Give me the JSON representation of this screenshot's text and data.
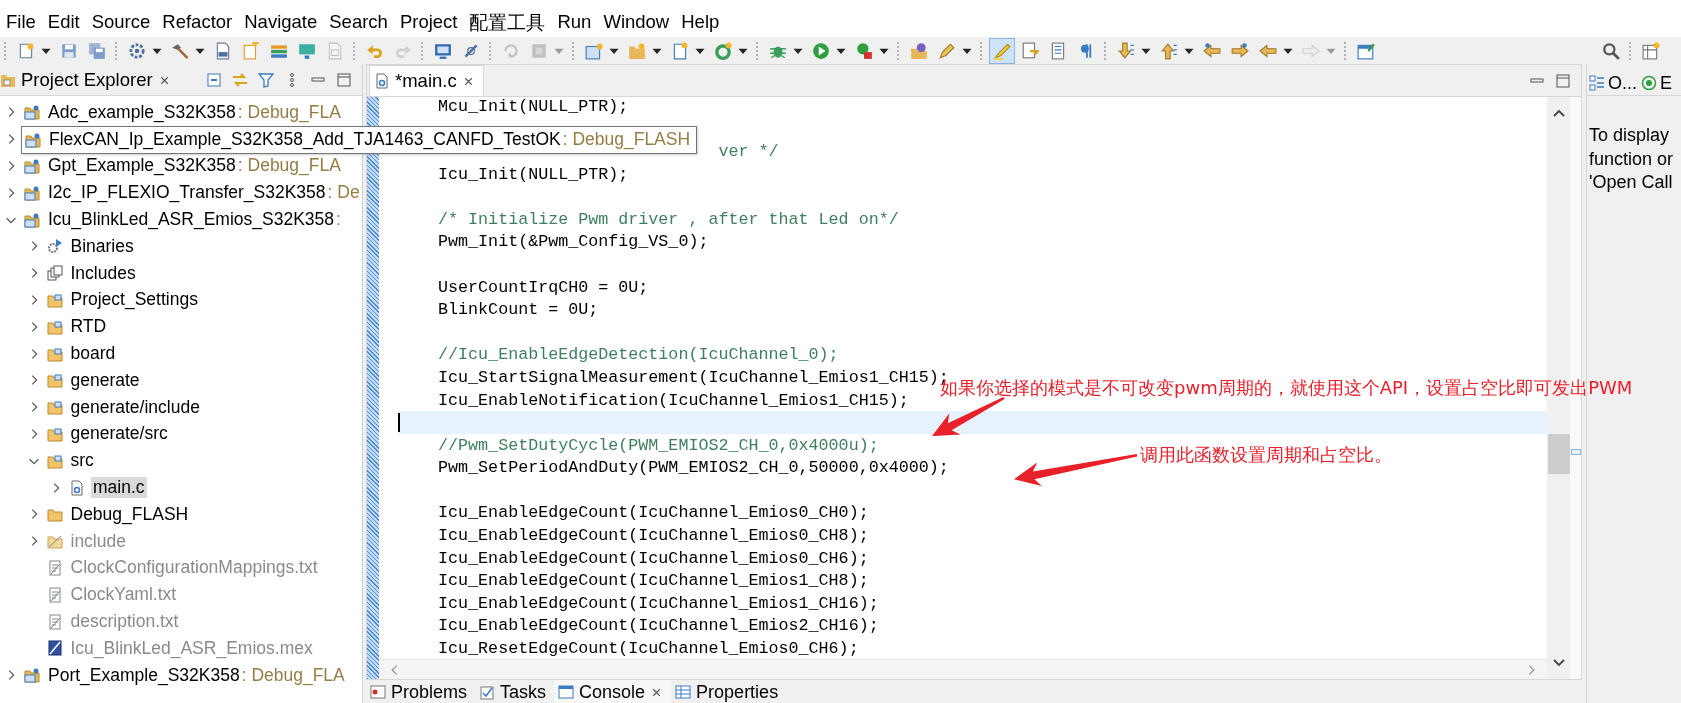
{
  "menu": [
    "File",
    "Edit",
    "Source",
    "Refactor",
    "Navigate",
    "Search",
    "Project",
    "配置工具",
    "Run",
    "Window",
    "Help"
  ],
  "toolbar": {
    "groups": [
      [
        {
          "dropdown": true,
          "selected": false,
          "disabled": false
        },
        {
          "dropdown": false,
          "selected": false,
          "disabled": false
        },
        {
          "dropdown": false,
          "selected": false,
          "disabled": false
        }
      ],
      [
        {
          "dropdown": true,
          "selected": false,
          "disabled": false
        },
        {
          "dropdown": true,
          "selected": false,
          "disabled": false
        },
        {
          "dropdown": false,
          "selected": false,
          "disabled": false
        },
        {
          "dropdown": false,
          "selected": false,
          "disabled": false
        },
        {
          "dropdown": false,
          "selected": false,
          "disabled": false
        },
        {
          "dropdown": false,
          "selected": false,
          "disabled": false
        },
        {
          "dropdown": false,
          "selected": false,
          "disabled": true
        }
      ],
      [
        {
          "dropdown": false,
          "selected": false,
          "disabled": false
        },
        {
          "dropdown": false,
          "selected": false,
          "disabled": true
        }
      ],
      [
        {
          "dropdown": false,
          "selected": false,
          "disabled": false
        },
        {
          "dropdown": false,
          "selected": false,
          "disabled": false
        }
      ],
      [
        {
          "dropdown": false,
          "selected": false,
          "disabled": true
        },
        {
          "dropdown": true,
          "selected": false,
          "disabled": true
        }
      ],
      [
        {
          "dropdown": true,
          "selected": false,
          "disabled": false
        },
        {
          "dropdown": true,
          "selected": false,
          "disabled": false
        },
        {
          "dropdown": true,
          "selected": false,
          "disabled": false
        },
        {
          "dropdown": true,
          "selected": false,
          "disabled": false
        }
      ],
      [
        {
          "dropdown": true,
          "selected": false,
          "disabled": false
        },
        {
          "dropdown": true,
          "selected": false,
          "disabled": false
        },
        {
          "dropdown": true,
          "selected": false,
          "disabled": false
        }
      ],
      [
        {
          "dropdown": false,
          "selected": false,
          "disabled": false
        },
        {
          "dropdown": true,
          "selected": false,
          "disabled": false
        }
      ],
      [
        {
          "dropdown": false,
          "selected": true,
          "disabled": false
        },
        {
          "dropdown": false,
          "selected": false,
          "disabled": false
        },
        {
          "dropdown": false,
          "selected": false,
          "disabled": false
        },
        {
          "dropdown": false,
          "selected": false,
          "disabled": false
        }
      ],
      [
        {
          "dropdown": true,
          "selected": false,
          "disabled": false
        },
        {
          "dropdown": true,
          "selected": false,
          "disabled": false
        },
        {
          "dropdown": false,
          "selected": false,
          "disabled": false
        },
        {
          "dropdown": false,
          "selected": false,
          "disabled": false
        },
        {
          "dropdown": true,
          "selected": false,
          "disabled": false
        },
        {
          "dropdown": true,
          "selected": false,
          "disabled": true
        }
      ],
      [
        {
          "dropdown": false,
          "selected": false,
          "disabled": false
        }
      ]
    ]
  },
  "project_explorer": {
    "title": "Project Explorer",
    "items": [
      {
        "label": "Adc_example_S32K358",
        "decoration": ": Debug_FLA",
        "kind": "project",
        "expanded": false,
        "selected": false,
        "dimmed": false,
        "tooltip": false
      },
      {
        "label": "FlexCAN_Ip_Example_S32K358_Add_TJA1463_CANFD_TestOK",
        "decoration": ": Debug_FLASH",
        "kind": "project",
        "expanded": false,
        "selected": false,
        "dimmed": false,
        "tooltip": true
      },
      {
        "label": "Gpt_Example_S32K358",
        "decoration": ": Debug_FLA",
        "kind": "project",
        "expanded": false,
        "selected": false,
        "dimmed": false,
        "tooltip": false
      },
      {
        "label": "I2c_IP_FLEXIO_Transfer_S32K358",
        "decoration": ": De",
        "kind": "project",
        "expanded": false,
        "selected": false,
        "dimmed": false,
        "tooltip": false
      },
      {
        "label": "Icu_BlinkLed_ASR_Emios_S32K358",
        "decoration": ":",
        "kind": "project",
        "expanded": true,
        "selected": false,
        "dimmed": false,
        "tooltip": false,
        "children": [
          {
            "label": "Binaries",
            "kind": "binaries",
            "expanded": false,
            "selected": false,
            "dimmed": false
          },
          {
            "label": "Includes",
            "kind": "includes",
            "expanded": false,
            "selected": false,
            "dimmed": false
          },
          {
            "label": "Project_Settings",
            "kind": "source_folder",
            "expanded": false,
            "selected": false,
            "dimmed": false
          },
          {
            "label": "RTD",
            "kind": "source_folder",
            "expanded": false,
            "selected": false,
            "dimmed": false
          },
          {
            "label": "board",
            "kind": "source_folder",
            "expanded": false,
            "selected": false,
            "dimmed": false
          },
          {
            "label": "generate",
            "kind": "source_folder",
            "expanded": false,
            "selected": false,
            "dimmed": false
          },
          {
            "label": "generate/include",
            "kind": "source_folder",
            "expanded": false,
            "selected": false,
            "dimmed": false
          },
          {
            "label": "generate/src",
            "kind": "source_folder",
            "expanded": false,
            "selected": false,
            "dimmed": false
          },
          {
            "label": "src",
            "kind": "source_folder",
            "expanded": true,
            "selected": false,
            "dimmed": false,
            "children": [
              {
                "label": "main.c",
                "kind": "c_file",
                "expanded": false,
                "selected": true,
                "dimmed": false
              }
            ]
          },
          {
            "label": "Debug_FLASH",
            "kind": "folder",
            "expanded": false,
            "selected": false,
            "dimmed": false
          },
          {
            "label": "include",
            "kind": "excluded_folder",
            "expanded": false,
            "selected": false,
            "dimmed": true
          },
          {
            "label": "ClockConfigurationMappings.txt",
            "kind": "text_file",
            "selected": false,
            "dimmed": true
          },
          {
            "label": "ClockYaml.txt",
            "kind": "text_file",
            "selected": false,
            "dimmed": true
          },
          {
            "label": "description.txt",
            "kind": "text_file",
            "selected": false,
            "dimmed": true
          },
          {
            "label": "Icu_BlinkLed_ASR_Emios.mex",
            "kind": "mex_file",
            "selected": false,
            "dimmed": true
          }
        ]
      },
      {
        "label": "Port_Example_S32K358",
        "decoration": ": Debug_FLA",
        "kind": "project",
        "expanded": false,
        "selected": false,
        "dimmed": false,
        "tooltip": false
      }
    ]
  },
  "editor": {
    "tabs": [
      {
        "label": "*main.c",
        "selected": true
      }
    ],
    "lines": [
      {
        "kind": "code",
        "text": "Mcu_Init(NULL_PTR);",
        "current": false
      },
      {
        "kind": "blank",
        "current": false
      },
      {
        "kind": "comment_tail",
        "text": "ver */",
        "current": false
      },
      {
        "kind": "code",
        "text": "Icu_Init(NULL_PTR);",
        "current": false
      },
      {
        "kind": "blank",
        "current": false
      },
      {
        "kind": "comment",
        "text": "/* Initialize Pwm driver , after that Led on*/",
        "current": false
      },
      {
        "kind": "code",
        "text": "Pwm_Init(&Pwm_Config_VS_0);",
        "current": false
      },
      {
        "kind": "blank",
        "current": false
      },
      {
        "kind": "code",
        "text": "UserCountIrqCH0 = 0U;",
        "current": false
      },
      {
        "kind": "code",
        "text": "BlinkCount = 0U;",
        "current": false
      },
      {
        "kind": "blank",
        "current": false
      },
      {
        "kind": "comment",
        "text": "//Icu_EnableEdgeDetection(IcuChannel_0);",
        "current": false
      },
      {
        "kind": "code",
        "text": "Icu_StartSignalMeasurement(IcuChannel_Emios1_CH15);",
        "current": false
      },
      {
        "kind": "code",
        "text": "Icu_EnableNotification(IcuChannel_Emios1_CH15);",
        "current": false
      },
      {
        "kind": "blank",
        "current": true
      },
      {
        "kind": "comment",
        "text": "//Pwm_SetDutyCycle(PWM_EMIOS2_CH_0,0x4000u);",
        "current": false
      },
      {
        "kind": "code",
        "text": "Pwm_SetPeriodAndDuty(PWM_EMIOS2_CH_0,50000,0x4000);",
        "current": false
      },
      {
        "kind": "blank",
        "current": false
      },
      {
        "kind": "code",
        "text": "Icu_EnableEdgeCount(IcuChannel_Emios0_CH0);",
        "current": false
      },
      {
        "kind": "code",
        "text": "Icu_EnableEdgeCount(IcuChannel_Emios0_CH8);",
        "current": false
      },
      {
        "kind": "code",
        "text": "Icu_EnableEdgeCount(IcuChannel_Emios0_CH6);",
        "current": false
      },
      {
        "kind": "code",
        "text": "Icu_EnableEdgeCount(IcuChannel_Emios1_CH8);",
        "current": false
      },
      {
        "kind": "code",
        "text": "Icu_EnableEdgeCount(IcuChannel_Emios1_CH16);",
        "current": false
      },
      {
        "kind": "code",
        "text": "Icu_EnableEdgeCount(IcuChannel_Emios2_CH16);",
        "current": false
      },
      {
        "kind": "code",
        "text": "Icu_ResetEdgeCount(IcuChannel_Emios0_CH6);",
        "current": false
      }
    ]
  },
  "side_panel": {
    "tabs": [
      {
        "label": "O...",
        "kind": "outline",
        "selected": false
      },
      {
        "label": "E",
        "kind": "target",
        "selected": false
      }
    ],
    "message_lines": [
      "To display",
      "function or",
      "'Open Call"
    ]
  },
  "bottom_panel": {
    "tabs": [
      {
        "label": "Problems",
        "kind": "problems",
        "selected": false
      },
      {
        "label": "Tasks",
        "kind": "tasks",
        "selected": false
      },
      {
        "label": "Console",
        "kind": "console",
        "selected": true
      },
      {
        "label": "Properties",
        "kind": "properties",
        "selected": false
      }
    ]
  },
  "annotations": [
    {
      "text": "如果你选择的模式是不可改变pwm周期的，就使用这个API，设置占空比即可发出PWM"
    },
    {
      "text": "调用此函数设置周期和占空比。"
    }
  ]
}
